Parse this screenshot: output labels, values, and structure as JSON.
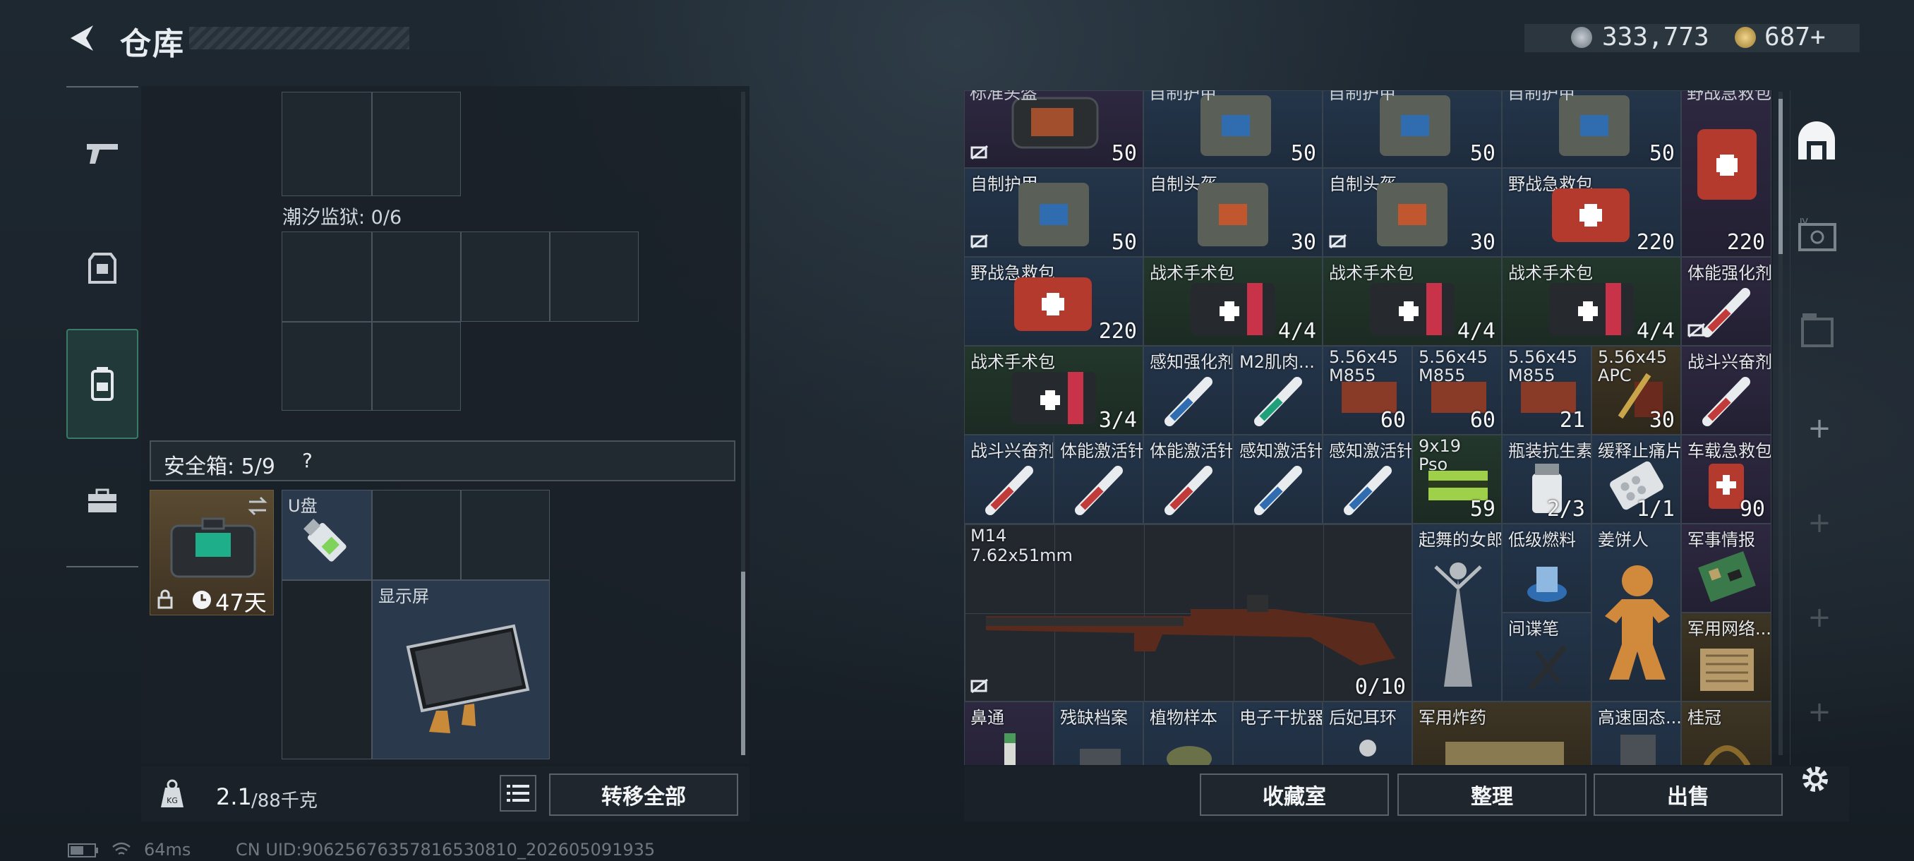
{
  "header": {
    "title": "仓库",
    "currency1": "333,773",
    "currency2": "687+"
  },
  "left": {
    "zone1_label": "潮汐监狱: 0/6",
    "safe_label": "安全箱: 5/9",
    "safe_help": "?",
    "safe_days": "47天",
    "item_usb": "U盘",
    "item_screen": "显示屏",
    "weight": "2.1",
    "weight_max": "/88千克",
    "transfer_all": "转移全部"
  },
  "grid": {
    "r0": [
      "标准头盔",
      "自制护甲",
      "自制护甲",
      "自制护甲",
      "野战急救包"
    ],
    "q0": [
      "50",
      "50",
      "50",
      "50",
      ""
    ],
    "r1": [
      "自制护甲",
      "自制头盔",
      "自制头盔",
      "野战急救包"
    ],
    "q1": [
      "50",
      "30",
      "30",
      "220",
      "220"
    ],
    "r2": [
      "野战急救包",
      "战术手术包",
      "战术手术包",
      "战术手术包",
      "体能强化剂"
    ],
    "q2": [
      "220",
      "4/4",
      "4/4",
      "4/4"
    ],
    "r3": [
      "战术手术包",
      "感知强化剂",
      "M2肌肉...",
      "5.56x45\nM855",
      "5.56x45\nM855",
      "5.56x45\nM855",
      "5.56x45\nAPC",
      "战斗兴奋剂"
    ],
    "q3": [
      "3/4",
      "60",
      "60",
      "21",
      "30"
    ],
    "r4": [
      "战斗兴奋剂",
      "体能激活针",
      "体能激活针",
      "感知激活针",
      "感知激活针",
      "9x19\nPso",
      "瓶装抗生素",
      "缓释止痛片",
      "车载急救包"
    ],
    "q4": [
      "59",
      "2/3",
      "1/1",
      "90"
    ],
    "m14_name": "M14\n7.62x51mm",
    "m14_qty": "0/10",
    "r5": [
      "起舞的女郎",
      "低级燃料",
      "姜饼人",
      "军事情报",
      "间谍笔",
      "军用网络..."
    ],
    "r6": [
      "鼻通",
      "残缺档案",
      "植物样本",
      "电子干扰器",
      "后妃耳环",
      "军用炸药",
      "高速固态...",
      "桂冠"
    ]
  },
  "actions": {
    "collection": "收藏室",
    "sort": "整理",
    "sell": "出售"
  },
  "status": {
    "ping": "64ms",
    "uid": "CN UID:9062567635781653081​0_202605091935"
  }
}
